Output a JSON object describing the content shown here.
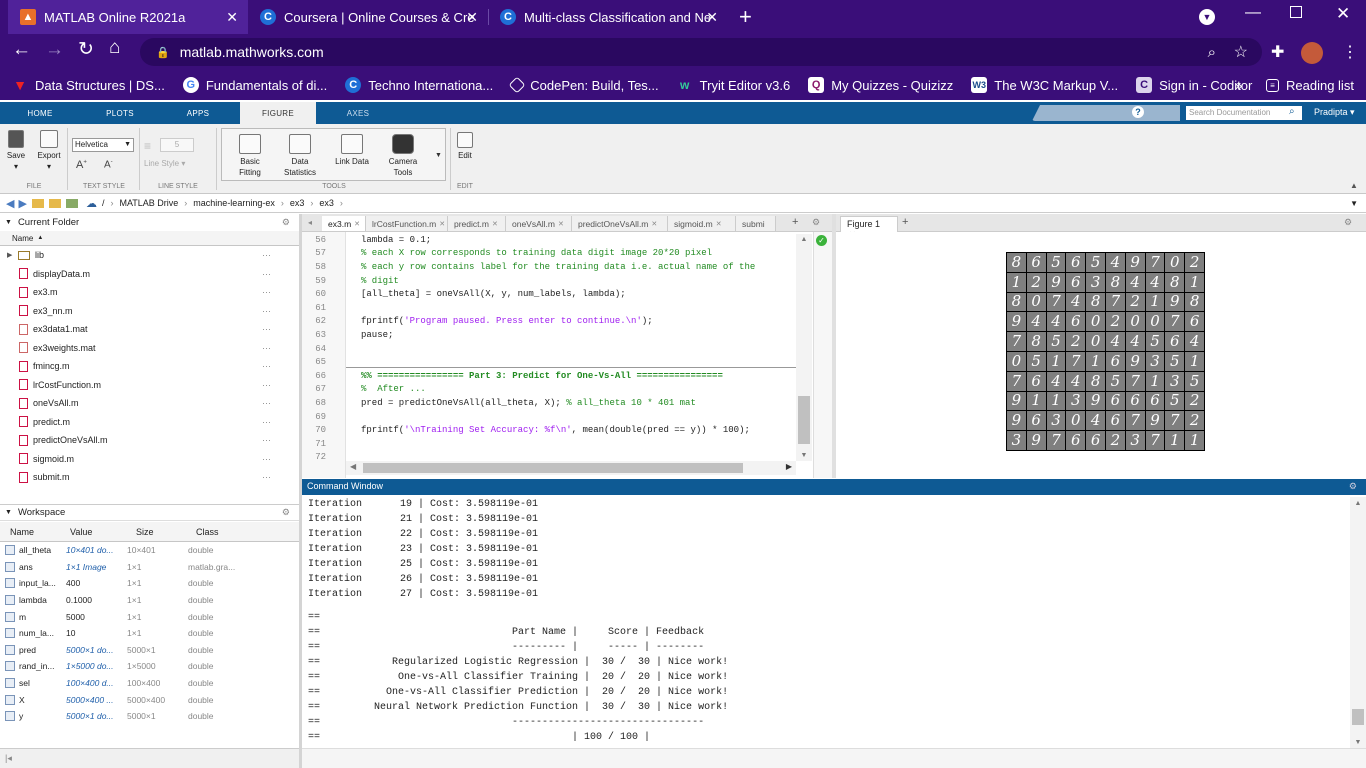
{
  "browser": {
    "tabs": [
      {
        "title": "MATLAB Online R2021a",
        "active": true
      },
      {
        "title": "Coursera | Online Courses & Cre",
        "active": false
      },
      {
        "title": "Multi-class Classification and Ne",
        "active": false
      }
    ],
    "new_tab": "+",
    "url": "matlab.mathworks.com",
    "bookmarks": [
      {
        "label": "Data Structures | DS...",
        "icon": "triangle-red-icon"
      },
      {
        "label": "Fundamentals of di...",
        "icon": "google-icon"
      },
      {
        "label": "Techno Internationa...",
        "icon": "coursera-icon"
      },
      {
        "label": "CodePen: Build, Tes...",
        "icon": "codepen-icon"
      },
      {
        "label": "Tryit Editor v3.6",
        "icon": "w3schools-icon"
      },
      {
        "label": "My Quizzes - Quizizz",
        "icon": "quizizz-icon"
      },
      {
        "label": "The W3C Markup V...",
        "icon": "w3c-icon"
      },
      {
        "label": "Sign in - Coditor",
        "icon": "coditor-icon"
      }
    ],
    "more_bookmarks": "»",
    "reading_list": "Reading list"
  },
  "matlab": {
    "toolstrip_tabs": [
      "HOME",
      "PLOTS",
      "APPS",
      "FIGURE",
      "AXES"
    ],
    "active_tab": "FIGURE",
    "search_placeholder": "Search Documentation",
    "user": "Pradipta",
    "toolstrip": {
      "save": "Save",
      "export": "Export",
      "file_group": "FILE",
      "font": "Helvetica",
      "text_group": "TEXT STYLE",
      "line_width": "5",
      "line_style": "Line Style",
      "line_group": "LINE STYLE",
      "basic_fitting": [
        "Basic",
        "Fitting"
      ],
      "data_statistics": [
        "Data",
        "Statistics"
      ],
      "link_data": "Link Data",
      "camera_tools": [
        "Camera",
        "Tools"
      ],
      "tools_group": "TOOLS",
      "edit": "Edit",
      "edit_group": "EDIT"
    },
    "path": [
      "/",
      "MATLAB Drive",
      "machine-learning-ex",
      "ex3",
      "ex3"
    ],
    "current_folder": {
      "title": "Current Folder",
      "column": "Name",
      "items": [
        "lib",
        "displayData.m",
        "ex3.m",
        "ex3_nn.m",
        "ex3data1.mat",
        "ex3weights.mat",
        "fmincg.m",
        "lrCostFunction.m",
        "oneVsAll.m",
        "predict.m",
        "predictOneVsAll.m",
        "sigmoid.m",
        "submit.m"
      ]
    },
    "workspace": {
      "title": "Workspace",
      "columns": [
        "Name",
        "Value",
        "Size",
        "Class"
      ],
      "rows": [
        {
          "name": "all_theta",
          "value": "10×401 do...",
          "size": "10×401",
          "class": "double",
          "link": true
        },
        {
          "name": "ans",
          "value": "1×1 Image",
          "size": "1×1",
          "class": "matlab.gra...",
          "link": true
        },
        {
          "name": "input_la...",
          "value": "400",
          "size": "1×1",
          "class": "double",
          "link": false
        },
        {
          "name": "lambda",
          "value": "0.1000",
          "size": "1×1",
          "class": "double",
          "link": false
        },
        {
          "name": "m",
          "value": "5000",
          "size": "1×1",
          "class": "double",
          "link": false
        },
        {
          "name": "num_la...",
          "value": "10",
          "size": "1×1",
          "class": "double",
          "link": false
        },
        {
          "name": "pred",
          "value": "5000×1 do...",
          "size": "5000×1",
          "class": "double",
          "link": true
        },
        {
          "name": "rand_in...",
          "value": "1×5000 do...",
          "size": "1×5000",
          "class": "double",
          "link": true
        },
        {
          "name": "sel",
          "value": "100×400 d...",
          "size": "100×400",
          "class": "double",
          "link": true
        },
        {
          "name": "X",
          "value": "5000×400 ...",
          "size": "5000×400",
          "class": "double",
          "link": true
        },
        {
          "name": "y",
          "value": "5000×1 do...",
          "size": "5000×1",
          "class": "double",
          "link": true
        }
      ]
    },
    "editor": {
      "tabs": [
        "ex3.m",
        "lrCostFunction.m",
        "predict.m",
        "oneVsAll.m",
        "predictOneVsAll.m",
        "sigmoid.m",
        "submi"
      ],
      "lines": [
        {
          "n": "56",
          "code": "lambda = 0.1;",
          "kind": "code"
        },
        {
          "n": "57",
          "code": "% each X row corresponds to training data digit image 20*20 pixel",
          "kind": "comment"
        },
        {
          "n": "58",
          "code": "% each y row contains label for the training data i.e. actual name of the",
          "kind": "comment"
        },
        {
          "n": "59",
          "code": "% digit",
          "kind": "comment"
        },
        {
          "n": "60",
          "code": "[all_theta] = oneVsAll(X, y, num_labels, lambda);",
          "kind": "code"
        },
        {
          "n": "61",
          "code": "",
          "kind": "code"
        },
        {
          "n": "62",
          "code_pre": "fprintf(",
          "code_str": "'Program paused. Press enter to continue.\\n'",
          "code_post": ");",
          "kind": "string"
        },
        {
          "n": "63",
          "code": "pause;",
          "kind": "code"
        },
        {
          "n": "64",
          "code": "",
          "kind": "code"
        },
        {
          "n": "65",
          "code": "",
          "kind": "code"
        },
        {
          "n": "66",
          "code": "%% ================ Part 3: Predict for One-Vs-All ================",
          "kind": "cell"
        },
        {
          "n": "67",
          "code": "%  After ...",
          "kind": "comment"
        },
        {
          "n": "68",
          "code_pre": "pred = predictOneVsAll(all_theta, X); ",
          "code_cmt": "% all_theta 10 * 401 mat",
          "kind": "mixed"
        },
        {
          "n": "69",
          "code": "",
          "kind": "code"
        },
        {
          "n": "70",
          "code_pre": "fprintf(",
          "code_str": "'\\nTraining Set Accuracy: %f\\n'",
          "code_post": ", mean(double(pred == y)) * 100);",
          "kind": "string"
        },
        {
          "n": "71",
          "code": "",
          "kind": "code"
        },
        {
          "n": "72",
          "code": "",
          "kind": "code"
        }
      ]
    },
    "figure": {
      "tab": "Figure 1",
      "digits": [
        "8",
        "6",
        "5",
        "6",
        "5",
        "4",
        "9",
        "7",
        "0",
        "2",
        "1",
        "2",
        "9",
        "6",
        "3",
        "8",
        "4",
        "4",
        "8",
        "1",
        "8",
        "0",
        "7",
        "4",
        "8",
        "7",
        "2",
        "1",
        "9",
        "8",
        "9",
        "4",
        "4",
        "6",
        "0",
        "2",
        "0",
        "0",
        "7",
        "6",
        "7",
        "8",
        "5",
        "2",
        "0",
        "4",
        "4",
        "5",
        "6",
        "4",
        "0",
        "5",
        "1",
        "7",
        "1",
        "6",
        "9",
        "3",
        "5",
        "1",
        "7",
        "6",
        "4",
        "4",
        "8",
        "5",
        "7",
        "1",
        "3",
        "5",
        "9",
        "1",
        "1",
        "3",
        "9",
        "6",
        "6",
        "6",
        "5",
        "2",
        "9",
        "6",
        "3",
        "0",
        "4",
        "6",
        "7",
        "9",
        "7",
        "2",
        "3",
        "9",
        "7",
        "6",
        "6",
        "2",
        "3",
        "7",
        "1",
        "1"
      ]
    },
    "command_window": {
      "title": "Command Window",
      "iterations": [
        {
          "label": "Iteration",
          "num": "19",
          "cost": "| Cost: 3.598119e-01"
        },
        {
          "label": "Iteration",
          "num": "21",
          "cost": "| Cost: 3.598119e-01"
        },
        {
          "label": "Iteration",
          "num": "22",
          "cost": "| Cost: 3.598119e-01"
        },
        {
          "label": "Iteration",
          "num": "23",
          "cost": "| Cost: 3.598119e-01"
        },
        {
          "label": "Iteration",
          "num": "25",
          "cost": "| Cost: 3.598119e-01"
        },
        {
          "label": "Iteration",
          "num": "26",
          "cost": "| Cost: 3.598119e-01"
        },
        {
          "label": "Iteration",
          "num": "27",
          "cost": "| Cost: 3.598119e-01"
        }
      ],
      "results": [
        "==",
        "==                                Part Name |     Score | Feedback",
        "==                                --------- |     ----- | --------",
        "==            Regularized Logistic Regression |  30 /  30 | Nice work!",
        "==             One-vs-All Classifier Training |  20 /  20 | Nice work!",
        "==           One-vs-All Classifier Prediction |  20 /  20 | Nice work!",
        "==         Neural Network Prediction Function |  30 /  30 | Nice work!",
        "==                                --------------------------------",
        "==                                          | 100 / 100 |"
      ]
    }
  }
}
